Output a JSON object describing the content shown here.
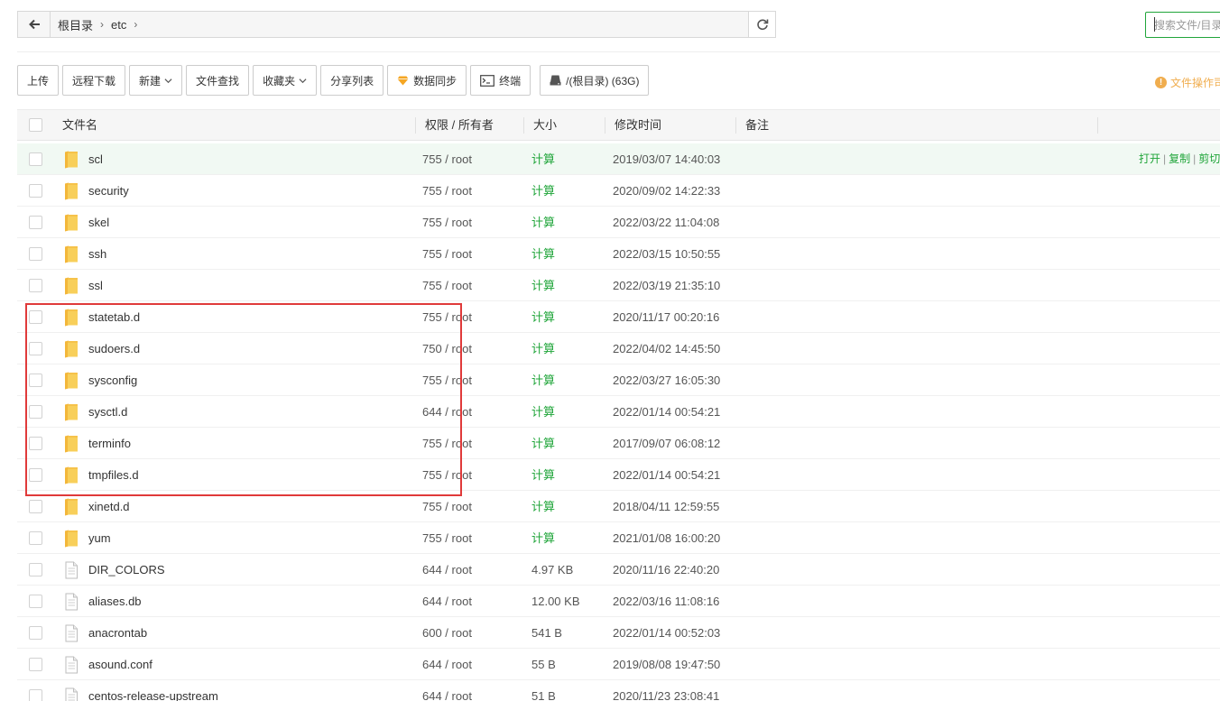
{
  "pathbar": {
    "crumbs": [
      "根目录",
      "etc"
    ]
  },
  "search": {
    "placeholder": "搜索文件/目录"
  },
  "toolbar": {
    "upload": "上传",
    "remote_download": "远程下载",
    "new": "新建",
    "file_search": "文件查找",
    "favorites": "收藏夹",
    "share_list": "分享列表",
    "data_sync": "数据同步",
    "terminal": "终端",
    "disk": "/(根目录) (63G)"
  },
  "ops_hint": "文件操作司",
  "table": {
    "headers": {
      "name": "文件名",
      "perm": "权限 / 所有者",
      "size": "大小",
      "mtime": "修改时间",
      "note": "备注"
    },
    "row_ops": {
      "open": "打开",
      "copy": "复制",
      "cut": "剪切"
    },
    "rows": [
      {
        "name": "scl",
        "type": "folder",
        "perm": "755 / root",
        "size": "计算",
        "mtime": "2019/03/07 14:40:03"
      },
      {
        "name": "security",
        "type": "folder",
        "perm": "755 / root",
        "size": "计算",
        "mtime": "2020/09/02 14:22:33"
      },
      {
        "name": "skel",
        "type": "folder",
        "perm": "755 / root",
        "size": "计算",
        "mtime": "2022/03/22 11:04:08"
      },
      {
        "name": "ssh",
        "type": "folder",
        "perm": "755 / root",
        "size": "计算",
        "mtime": "2022/03/15 10:50:55"
      },
      {
        "name": "ssl",
        "type": "folder",
        "perm": "755 / root",
        "size": "计算",
        "mtime": "2022/03/19 21:35:10"
      },
      {
        "name": "statetab.d",
        "type": "folder",
        "perm": "755 / root",
        "size": "计算",
        "mtime": "2020/11/17 00:20:16"
      },
      {
        "name": "sudoers.d",
        "type": "folder",
        "perm": "750 / root",
        "size": "计算",
        "mtime": "2022/04/02 14:45:50"
      },
      {
        "name": "sysconfig",
        "type": "folder",
        "perm": "755 / root",
        "size": "计算",
        "mtime": "2022/03/27 16:05:30"
      },
      {
        "name": "sysctl.d",
        "type": "folder",
        "perm": "644 / root",
        "size": "计算",
        "mtime": "2022/01/14 00:54:21"
      },
      {
        "name": "terminfo",
        "type": "folder",
        "perm": "755 / root",
        "size": "计算",
        "mtime": "2017/09/07 06:08:12"
      },
      {
        "name": "tmpfiles.d",
        "type": "folder",
        "perm": "755 / root",
        "size": "计算",
        "mtime": "2022/01/14 00:54:21"
      },
      {
        "name": "xinetd.d",
        "type": "folder",
        "perm": "755 / root",
        "size": "计算",
        "mtime": "2018/04/11 12:59:55"
      },
      {
        "name": "yum",
        "type": "folder",
        "perm": "755 / root",
        "size": "计算",
        "mtime": "2021/01/08 16:00:20"
      },
      {
        "name": "DIR_COLORS",
        "type": "file",
        "perm": "644 / root",
        "size": "4.97 KB",
        "mtime": "2020/11/16 22:40:20"
      },
      {
        "name": "aliases.db",
        "type": "file",
        "perm": "644 / root",
        "size": "12.00 KB",
        "mtime": "2022/03/16 11:08:16"
      },
      {
        "name": "anacrontab",
        "type": "file",
        "perm": "600 / root",
        "size": "541 B",
        "mtime": "2022/01/14 00:52:03"
      },
      {
        "name": "asound.conf",
        "type": "file",
        "perm": "644 / root",
        "size": "55 B",
        "mtime": "2019/08/08 19:47:50"
      },
      {
        "name": "centos-release-upstream",
        "type": "file",
        "perm": "644 / root",
        "size": "51 B",
        "mtime": "2020/11/23 23:08:41"
      }
    ]
  },
  "colors": {
    "accent": "#20a53a",
    "highlight": "#e03a3a",
    "folder": "#f8c84a",
    "warning": "#f0ad4e"
  }
}
